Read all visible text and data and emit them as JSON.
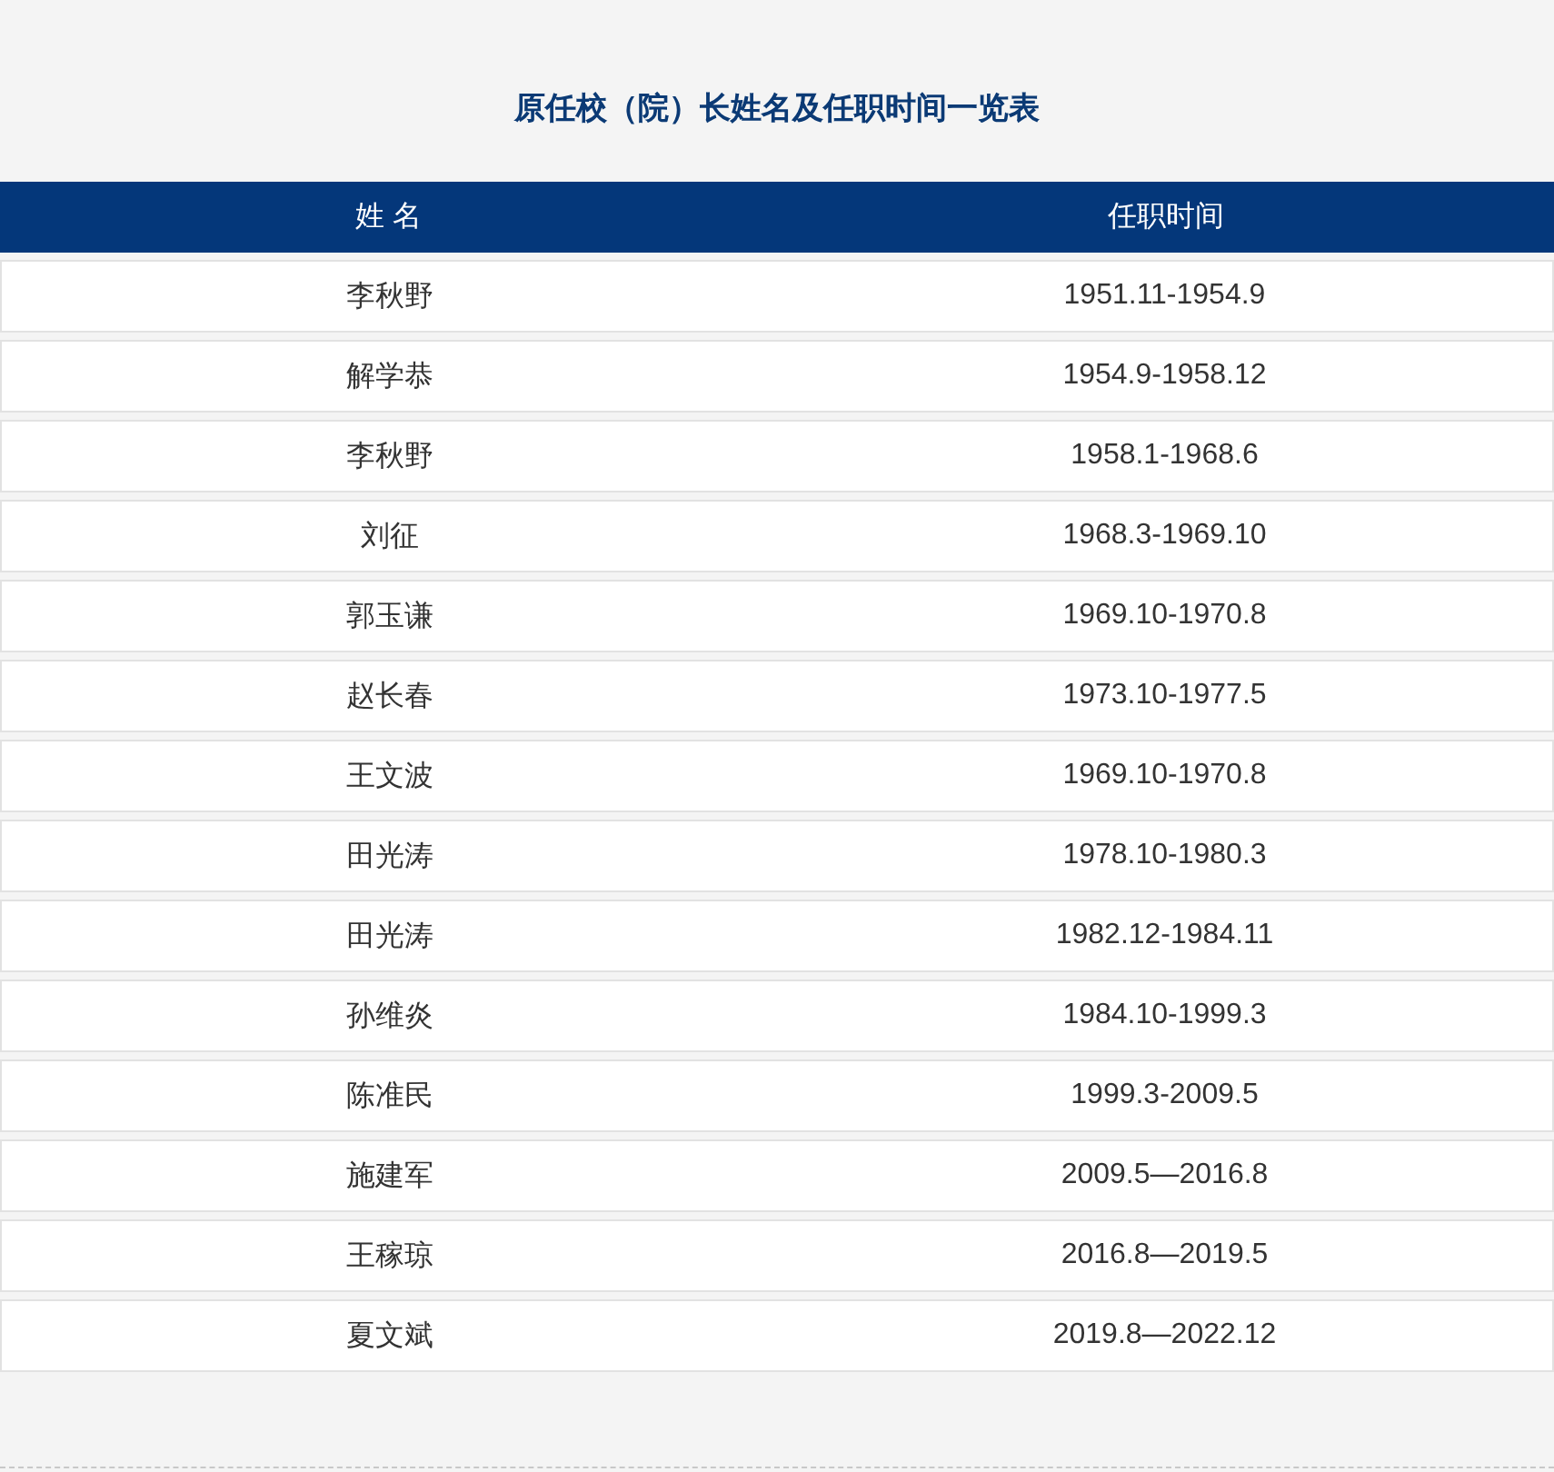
{
  "title": "原任校（院）长姓名及任职时间一览表",
  "table": {
    "columns": [
      "姓 名",
      "任职时间"
    ],
    "rows": [
      [
        "李秋野",
        "1951.11-1954.9"
      ],
      [
        "解学恭",
        "1954.9-1958.12"
      ],
      [
        "李秋野",
        "1958.1-1968.6"
      ],
      [
        "刘征",
        "1968.3-1969.10"
      ],
      [
        "郭玉谦",
        "1969.10-1970.8"
      ],
      [
        "赵长春",
        "1973.10-1977.5"
      ],
      [
        "王文波",
        "1969.10-1970.8"
      ],
      [
        "田光涛",
        "1978.10-1980.3"
      ],
      [
        "田光涛",
        "1982.12-1984.11"
      ],
      [
        "孙维炎",
        "1984.10-1999.3"
      ],
      [
        "陈准民",
        "1999.3-2009.5"
      ],
      [
        "施建军",
        "2009.5—2016.8"
      ],
      [
        "王稼琼",
        "2016.8—2019.5"
      ],
      [
        "夏文斌",
        "2019.8—2022.12"
      ]
    ]
  }
}
